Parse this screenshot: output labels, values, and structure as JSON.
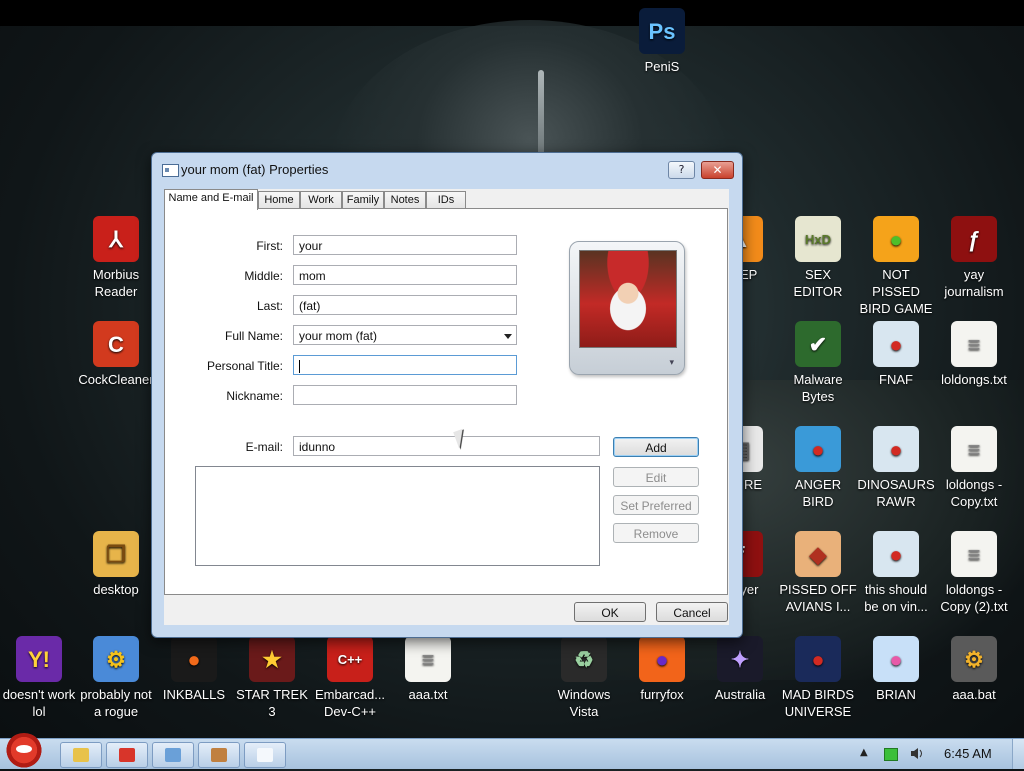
{
  "desktop": {
    "icons": [
      {
        "label": "PeniS",
        "glyph": "Ps",
        "icon": "photoshop-icon",
        "color": "#0a1c3a",
        "fg": "#6ac3ff"
      },
      {
        "label": "Morbius Reader",
        "glyph": "⅄",
        "icon": "acrobat-reader-icon",
        "color": "#c9201a",
        "fg": "#ffffff"
      },
      {
        "label": "CockCleaner",
        "glyph": "C",
        "icon": "ccleaner-icon",
        "color": "#d23a1e",
        "fg": "#ffffff"
      },
      {
        "label": "desktop",
        "glyph": "❐",
        "icon": "folder-icon",
        "color": "#e7b44a",
        "fg": "#7a4b10"
      },
      {
        "label": "BEEP",
        "glyph": "▲",
        "icon": "vlc-icon",
        "color": "#f28b1a",
        "fg": "#ffffff"
      },
      {
        "label": "SEX EDITOR",
        "glyph": "HxD",
        "icon": "hex-editor-icon",
        "color": "#e6e6d0",
        "fg": "#5a7a2a"
      },
      {
        "label": "NOT PISSED BIRD GAME",
        "glyph": "●",
        "icon": "angry-birds-pig-icon",
        "color": "#f5a31a",
        "fg": "#4fbf2a"
      },
      {
        "label": "yay journalism",
        "glyph": "ƒ",
        "icon": "flash-icon",
        "color": "#8e1010",
        "fg": "#ffffff"
      },
      {
        "label": "Malware Bytes",
        "glyph": "✔",
        "icon": "shield-icon",
        "color": "#2d6a2d",
        "fg": "#ffffff"
      },
      {
        "label": "FNAF",
        "glyph": "●",
        "icon": "angry-bird-icon",
        "color": "#d8e6f0",
        "fg": "#d22a22"
      },
      {
        "label": "loldongs.txt",
        "glyph": "≡",
        "icon": "text-file-icon",
        "color": "#f4f4f0",
        "fg": "#888888"
      },
      {
        "label": "IT!!! RE",
        "glyph": "▤",
        "icon": "document-icon",
        "color": "#e8e8e8",
        "fg": "#666666"
      },
      {
        "label": "ANGER BIRD",
        "glyph": "●",
        "icon": "angry-bird-icon",
        "color": "#3a9ad8",
        "fg": "#d22a22"
      },
      {
        "label": "DINOSAURS RAWR",
        "glyph": "●",
        "icon": "angry-bird-icon",
        "color": "#d8e6f0",
        "fg": "#d22a22"
      },
      {
        "label": "loldongs - Copy.txt",
        "glyph": "≡",
        "icon": "text-file-icon",
        "color": "#f4f4f0",
        "fg": "#888888"
      },
      {
        "label": "Player",
        "glyph": "ƒ",
        "icon": "flash-player-icon",
        "color": "#8e1010",
        "fg": "#ffffff"
      },
      {
        "label": "PISSED OFF AVIANS I...",
        "glyph": "◆",
        "icon": "angry-birds-seasons-icon",
        "color": "#e9b17a",
        "fg": "#b03020"
      },
      {
        "label": "this should be on vin...",
        "glyph": "●",
        "icon": "angry-bird-icon",
        "color": "#d8e6f0",
        "fg": "#d22a22"
      },
      {
        "label": "loldongs - Copy (2).txt",
        "glyph": "≡",
        "icon": "text-file-icon",
        "color": "#f4f4f0",
        "fg": "#888888"
      },
      {
        "label": "doesn't work lol",
        "glyph": "Y!",
        "icon": "yahoo-messenger-icon",
        "color": "#6a2aa8",
        "fg": "#ffd23a"
      },
      {
        "label": "probably not a rogue",
        "glyph": "⚙",
        "icon": "system-tool-icon",
        "color": "#4a8ad8",
        "fg": "#f5c21a"
      },
      {
        "label": "INKBALLS",
        "glyph": "●",
        "icon": "inkball-icon",
        "color": "#1a1a1a",
        "fg": "#f26a1a"
      },
      {
        "label": "STAR TREK 3",
        "glyph": "★",
        "icon": "star-wars-icon",
        "color": "#6a1a1a",
        "fg": "#ffcc33"
      },
      {
        "label": "Embarcad... Dev-C++",
        "glyph": "C++",
        "icon": "dev-cpp-icon",
        "color": "#c8201a",
        "fg": "#ffffff"
      },
      {
        "label": "aaa.txt",
        "glyph": "≡",
        "icon": "text-file-icon",
        "color": "#f4f4f0",
        "fg": "#888888"
      },
      {
        "label": "Windows Vista",
        "glyph": "♻",
        "icon": "recycle-bin-icon",
        "color": "#2a2a2a",
        "fg": "#9ad0a0"
      },
      {
        "label": "furryfox",
        "glyph": "●",
        "icon": "firefox-icon",
        "color": "#f2641a",
        "fg": "#6a2ac8"
      },
      {
        "label": "Australia",
        "glyph": "✦",
        "icon": "spider-solitaire-icon",
        "color": "#1a1a2a",
        "fg": "#c0a0ff"
      },
      {
        "label": "MAD BIRDS UNIVERSE",
        "glyph": "●",
        "icon": "angry-birds-space-icon",
        "color": "#1a2a5a",
        "fg": "#d22a22"
      },
      {
        "label": "BRIAN",
        "glyph": "●",
        "icon": "pink-bird-icon",
        "color": "#c8e0f8",
        "fg": "#e85aa8"
      },
      {
        "label": "aaa.bat",
        "glyph": "⚙",
        "icon": "batch-file-icon",
        "color": "#5a5a5a",
        "fg": "#f2b22a"
      }
    ]
  },
  "dialog": {
    "title": "your mom (fat) Properties",
    "help_label": "?",
    "close_label": "✕",
    "tabs": [
      "Name and E-mail",
      "Home",
      "Work",
      "Family",
      "Notes",
      "IDs"
    ],
    "fields": {
      "first": {
        "label": "First:",
        "value": "your"
      },
      "middle": {
        "label": "Middle:",
        "value": "mom"
      },
      "last": {
        "label": "Last:",
        "value": "(fat)"
      },
      "full_name": {
        "label": "Full Name:",
        "value": "your mom (fat)"
      },
      "personal_title": {
        "label": "Personal Title:",
        "value": ""
      },
      "nickname": {
        "label": "Nickname:",
        "value": ""
      },
      "email": {
        "label": "E-mail:",
        "value": "idunno"
      }
    },
    "buttons": {
      "add": "Add",
      "edit": "Edit",
      "set_preferred": "Set Preferred",
      "remove": "Remove",
      "ok": "OK",
      "cancel": "Cancel"
    },
    "photo_arrow": "▾"
  },
  "taskbar": {
    "clock": "6:45 AM",
    "tray_expand": "▲",
    "buttons": [
      {
        "icon": "explorer-folder-icon",
        "color": "#e8c24a"
      },
      {
        "icon": "chrome-icon",
        "color": "#d8352a"
      },
      {
        "icon": "control-panel-icon",
        "color": "#6aa0d8"
      },
      {
        "icon": "paint-icon",
        "color": "#c08040"
      },
      {
        "icon": "contacts-window-icon",
        "color": "#f4f8fc"
      }
    ]
  }
}
